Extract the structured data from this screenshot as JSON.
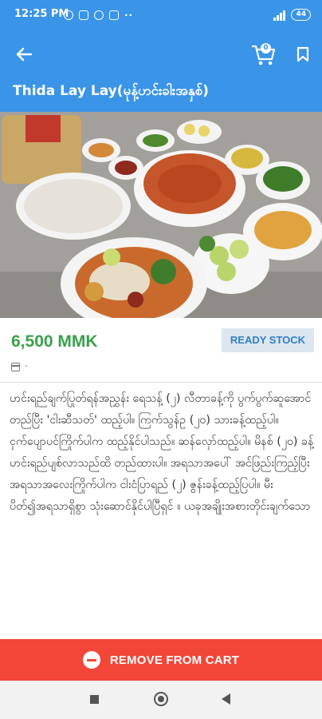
{
  "status_bar": {
    "time": "12:25 PM",
    "notification_icons": [
      "alarm-icon",
      "gallery-icon",
      "facebook-icon",
      "messenger-icon"
    ],
    "overflow": "··",
    "battery": "44"
  },
  "app_bar": {
    "cart_count": "0",
    "shop_title": "Thida Lay Lay(မုန့်ဟင်းခါးအနှစ်)",
    "color": "#3a94e8"
  },
  "product": {
    "image_alt": "Mohinga dishes",
    "price": "6,500 MMK",
    "stock_status": "READY STOCK",
    "date": "-",
    "description": "ဟင်းရည်ချက်ပြုတ်ရန်အညွှန်း ရေသန့် (၂) လီတာခန့်ကို ပွက်ပွက်ဆူအောင်တည်ပြီး 'ငါးဆီသတ်' ထည့်ပါ။ ကြက်သွန်ဥ (၂၀) သားခန့်ထည့်ပါ။ ငှက်ပျောပင်ကြိုက်ပါက ထည့်နိုင်ပါသည်။ ဆန်လှော်ထည့်ပါ။ မိနစ် (၂၀) ခန့် ဟင်းရည်ပျစ်လာသည်ထိ တည်ထားပါ။ အရသာအပေါ် အင်ဖြည်းကြည့်ပြီး အရသာအလေးကြိုက်ပါက ငါးငံပြာရည် (၂) ဇွန်းခန့်ထည့်ပြပါ။ မီးပိတ်၍အရသာရှိစွာ သုံးဆောင်နိုင်ပါပြီရှင် ။ ယခုအချိုးအစားတိုင်းချက်သော"
  },
  "actions": {
    "remove_label": "REMOVE FROM CART",
    "remove_color": "#f14638"
  },
  "colors": {
    "price": "#3aa14a",
    "badge_text": "#2e7ec8"
  }
}
